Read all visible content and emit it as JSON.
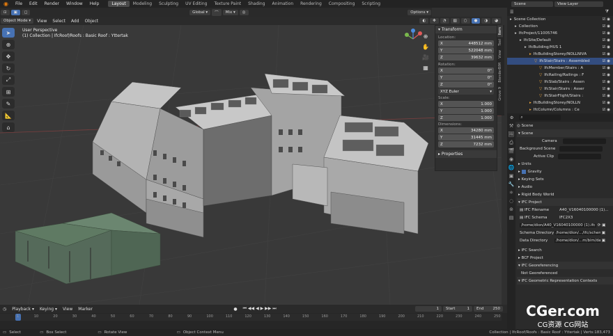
{
  "topbar": {
    "menus": [
      "File",
      "Edit",
      "Render",
      "Window",
      "Help"
    ],
    "workspaces": [
      "Layout",
      "Modeling",
      "Sculpting",
      "UV Editing",
      "Texture Paint",
      "Shading",
      "Animation",
      "Rendering",
      "Compositing",
      "Scripting"
    ],
    "active_workspace": "Layout",
    "scene_label": "Scene",
    "view_layer_label": "View Layer"
  },
  "vp_header": {
    "transform_orientation": "Global",
    "pivot": "Mix",
    "options": "Options"
  },
  "vp_header2": {
    "mode": "Object Mode",
    "view": "View",
    "select": "Select",
    "add": "Add",
    "object": "Object"
  },
  "viewport": {
    "title": "User Perspective",
    "subtitle": "(1) Collection | IfcRoof/Roofs : Basic Roof : Yttertak"
  },
  "npanel": {
    "section": "Transform",
    "location_label": "Location:",
    "location": [
      "448512 mm",
      "522048 mm",
      "39632 mm"
    ],
    "rotation_label": "Rotation:",
    "rotation": [
      "0°",
      "0°",
      "0°"
    ],
    "rotation_mode": "XYZ Euler",
    "scale_label": "Scale:",
    "scale": [
      "1.000",
      "1.000",
      "1.000"
    ],
    "dimensions_label": "Dimensions:",
    "dimensions": [
      "34280 mm",
      "31445 mm",
      "7232 mm"
    ],
    "axes": [
      "X",
      "Y",
      "Z"
    ],
    "properties_section": "Properties",
    "tabs": [
      "Item",
      "Tool",
      "View",
      "BlenderBIM",
      "Grove 9"
    ]
  },
  "outliner": {
    "items": [
      {
        "label": "Scene Collection",
        "depth": 0
      },
      {
        "label": "Collection",
        "depth": 1
      },
      {
        "label": "IfcProject/11005746",
        "depth": 1
      },
      {
        "label": "IfcSite/Default",
        "depth": 2
      },
      {
        "label": "IfcBuilding/HUS 1",
        "depth": 3
      },
      {
        "label": "IfcBuildingStorey/NOLLNIVÅ",
        "depth": 4
      },
      {
        "label": "IfcStair/Stairs : Assembled",
        "depth": 5
      },
      {
        "label": "IfcMember/Stairs : A",
        "depth": 6
      },
      {
        "label": "IfcRailing/Railings : F",
        "depth": 6
      },
      {
        "label": "IfcSlab/Stairs : Assen",
        "depth": 6
      },
      {
        "label": "IfcStair/Stairs : Asser",
        "depth": 6
      },
      {
        "label": "IfcStairFlight/Stairs :",
        "depth": 6
      },
      {
        "label": "IfcBuildingStorey/NOLLN",
        "depth": 4
      },
      {
        "label": "IfcColumn/Columns : Ce",
        "depth": 4
      }
    ]
  },
  "properties": {
    "header": "Scene",
    "scene_section": "Scene",
    "camera_label": "Camera",
    "background_scene_label": "Background Scene",
    "active_clip_label": "Active Clip",
    "units": "Units",
    "gravity": "Gravity",
    "keying_sets": "Keying Sets",
    "audio": "Audio",
    "rigid_body_world": "Rigid Body World",
    "ifc_project": "IFC Project",
    "ifc_filename_label": "IFC Filename",
    "ifc_filename": "A40_V16040100000 (1)...",
    "ifc_schema_label": "IFC Schema",
    "ifc_schema": "IFC2X3",
    "ifc_path": "/home/dion/A40_V16040100000 (1).ifc",
    "schema_dir_label": "Schema Directory",
    "schema_dir": "/home/dion/.../ifc/schema/",
    "data_dir_label": "Data Directory",
    "data_dir": "/home/dion/...m/bim/data/",
    "ifc_search": "IFC Search",
    "bcf_project": "BCF Project",
    "ifc_georef": "IFC Georeferencing",
    "not_georef": "Not Georeferenced",
    "ifc_geom_contexts": "IFC Geometric Representation Contexts"
  },
  "timeline": {
    "playback": "Playback",
    "keying": "Keying",
    "view": "View",
    "marker": "Marker",
    "current_frame": "1",
    "start_label": "Start",
    "start": "1",
    "end_label": "End",
    "end": "250",
    "ticks": [
      "1",
      "10",
      "20",
      "30",
      "40",
      "50",
      "60",
      "70",
      "80",
      "90",
      "100",
      "110",
      "120",
      "130",
      "140",
      "150",
      "160",
      "170",
      "180",
      "190",
      "200",
      "210",
      "220",
      "230",
      "240",
      "250"
    ]
  },
  "statusbar": {
    "select": "Select",
    "box_select": "Box Select",
    "rotate_view": "Rotate View",
    "context_menu": "Object Context Menu",
    "right_info": "Collection | IfcRoof/Roofs : Basic Roof : Yttertak | Verts:183,473"
  },
  "watermark": {
    "main": "CGer.com",
    "sub": "CG资源 CG网站"
  },
  "colors": {
    "accent": "#4772b3",
    "building": "#b8b8b8",
    "roof_panels": "#6a6a6a",
    "canopy": "#5f7a63"
  }
}
